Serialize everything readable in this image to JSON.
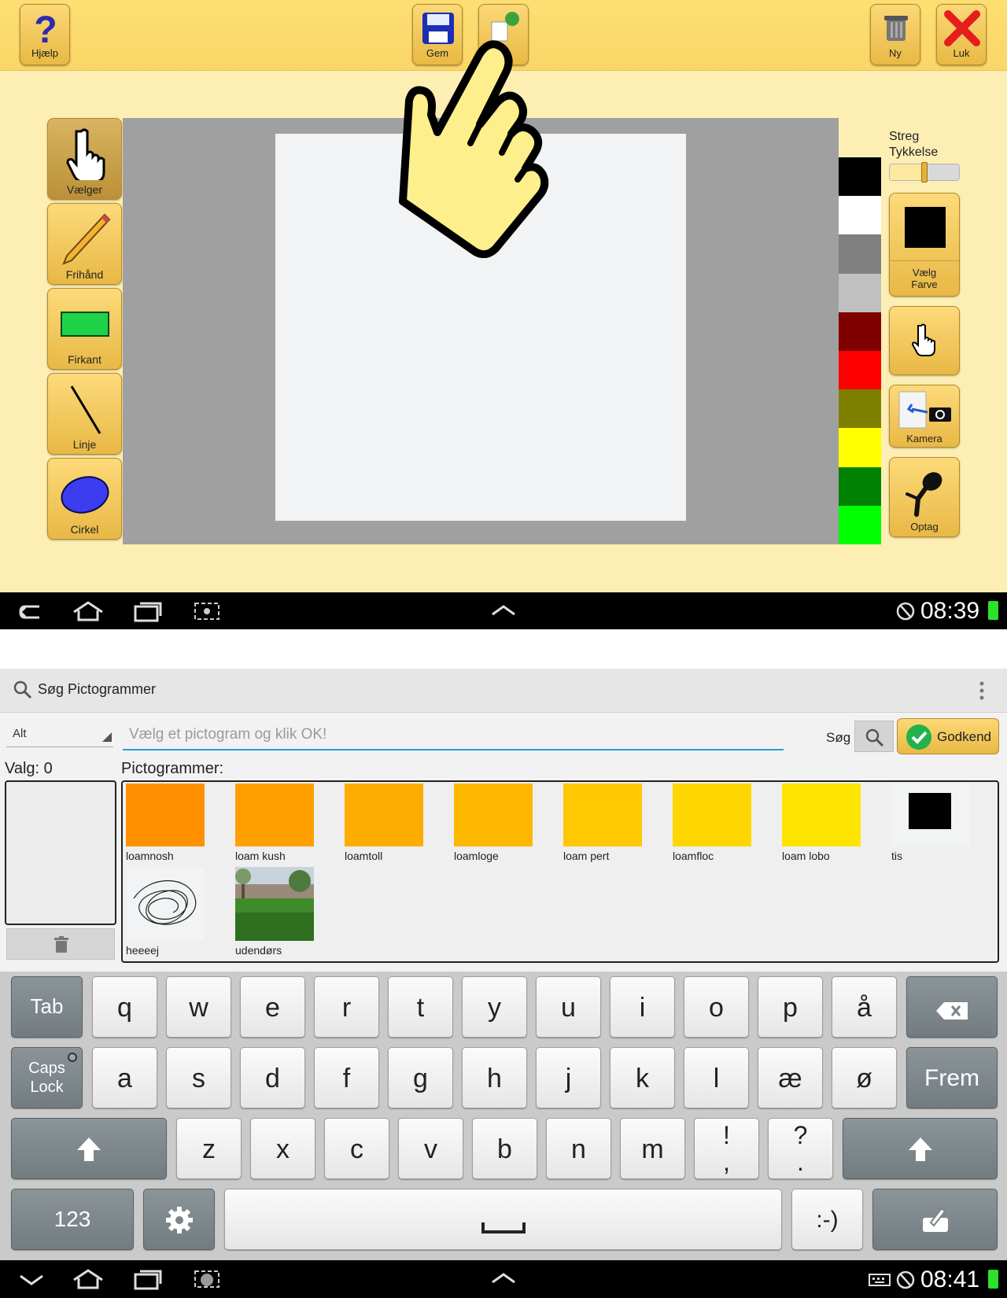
{
  "app": {
    "toolbar": {
      "help_label": "Hjælp",
      "save_label": "Gem",
      "new_label": "Ny",
      "close_label": "Luk"
    },
    "tools": [
      {
        "label": "Vælger",
        "icon": "hand-pointer-icon"
      },
      {
        "label": "Frihånd",
        "icon": "pencil-icon"
      },
      {
        "label": "Firkant",
        "icon": "rectangle-icon"
      },
      {
        "label": "Linje",
        "icon": "line-icon"
      },
      {
        "label": "Cirkel",
        "icon": "ellipse-icon"
      }
    ],
    "palette": [
      "#000000",
      "#ffffff",
      "#808080",
      "#c0c0c0",
      "#800000",
      "#ff0000",
      "#808000",
      "#ffff00",
      "#008000",
      "#00ff00"
    ],
    "right_panel": {
      "stroke_label_1": "Streg",
      "stroke_label_2": "Tykkelse",
      "stroke_value": 0.5,
      "color_label_1": "Vælg",
      "color_label_2": "Farve",
      "current_color": "#000000",
      "camera_label": "Kamera",
      "record_label": "Optag"
    }
  },
  "nav_top": {
    "clock": "08:39"
  },
  "dialog": {
    "title": "Søg Pictogrammer",
    "category": "Alt",
    "search_placeholder": "Vælg et pictogram og klik OK!",
    "search_label": "Søg",
    "confirm_label": "Godkend",
    "selection_label": "Valg: 0",
    "pictograms_label": "Pictogrammer:",
    "pictograms": [
      {
        "name": "loamnosh",
        "color": "#ff9100"
      },
      {
        "name": "loam kush",
        "color": "#ffa000"
      },
      {
        "name": "loamtoll",
        "color": "#ffac00"
      },
      {
        "name": "loamloge",
        "color": "#ffb800"
      },
      {
        "name": "loam pert",
        "color": "#ffc800"
      },
      {
        "name": "loamfloc",
        "color": "#ffd600"
      },
      {
        "name": "loam lobo",
        "color": "#ffe400"
      },
      {
        "name": "tis",
        "color": "#000000"
      },
      {
        "name": "heeeej",
        "color": "scribble"
      },
      {
        "name": "udendørs",
        "color": "photo"
      }
    ]
  },
  "keyboard": {
    "row1": [
      "q",
      "w",
      "e",
      "r",
      "t",
      "y",
      "u",
      "i",
      "o",
      "p",
      "å"
    ],
    "row2": [
      "a",
      "s",
      "d",
      "f",
      "g",
      "h",
      "j",
      "k",
      "l",
      "æ",
      "ø"
    ],
    "row3": [
      "z",
      "x",
      "c",
      "v",
      "b",
      "n",
      "m"
    ],
    "tab": "Tab",
    "caps_1": "Caps",
    "caps_2": "Lock",
    "enter": "Frem",
    "num": "123",
    "excl": "!",
    "excl_sub": ",",
    "quest": "?",
    "quest_sub": ".",
    "smiley": ":-)"
  },
  "nav_bottom": {
    "clock": "08:41"
  }
}
